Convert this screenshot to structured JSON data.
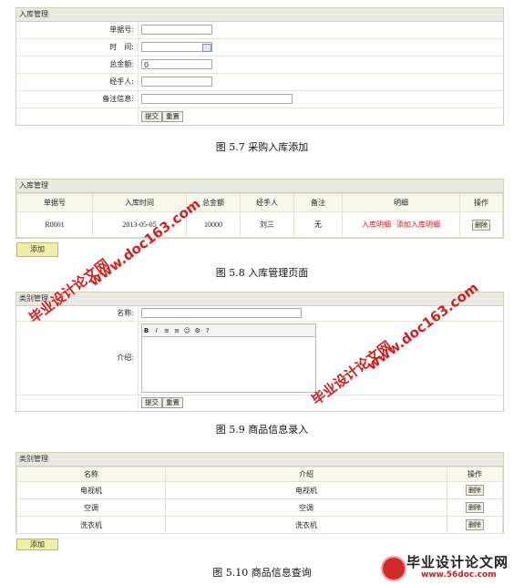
{
  "fig57": {
    "header": "入库管理",
    "fields": [
      {
        "label": "单据号:",
        "value": ""
      },
      {
        "label": "时　间:",
        "value": ""
      },
      {
        "label": "总金额:",
        "value": "0"
      },
      {
        "label": "经手人:",
        "value": ""
      },
      {
        "label": "备注信息:",
        "value": ""
      }
    ],
    "submit": "提交",
    "reset": "重置",
    "caption": "图 5.7 采购入库添加"
  },
  "fig58": {
    "header": "入库管理",
    "columns": [
      "单据号",
      "入库时间",
      "总金额",
      "经手人",
      "备注",
      "明细",
      "操作"
    ],
    "row": {
      "id": "R0001",
      "time": "2013-05-05",
      "amount": "10000",
      "handler": "刘三",
      "note": "无",
      "detail_link": "入库明细",
      "add_detail_link": "添加入库明细",
      "action": "删除"
    },
    "add_button": "添加",
    "caption": "图 5.8 入库管理页面"
  },
  "fig59": {
    "header": "类别管理",
    "name_label": "名称:",
    "intro_label": "介绍:",
    "toolbar": [
      "B",
      "I",
      "≡",
      "≡",
      "☺",
      "⚙",
      "?"
    ],
    "submit": "提交",
    "reset": "重置",
    "caption": "图 5.9 商品信息录入"
  },
  "fig510": {
    "header": "类别管理",
    "columns": [
      "名称",
      "介绍",
      "操作"
    ],
    "rows": [
      {
        "name": "电视机",
        "intro": "电视机",
        "action": "删除"
      },
      {
        "name": "空调",
        "intro": "空调",
        "action": "删除"
      },
      {
        "name": "洗衣机",
        "intro": "洗衣机",
        "action": "删除"
      }
    ],
    "add_button": "添加",
    "caption": "图 5.10 商品信息查询"
  },
  "watermarks": {
    "cn": "毕业设计论文网",
    "url": "www.doc163.com",
    "footer_cn": "毕业设计论文网",
    "footer_url": "www.56doc.com"
  }
}
